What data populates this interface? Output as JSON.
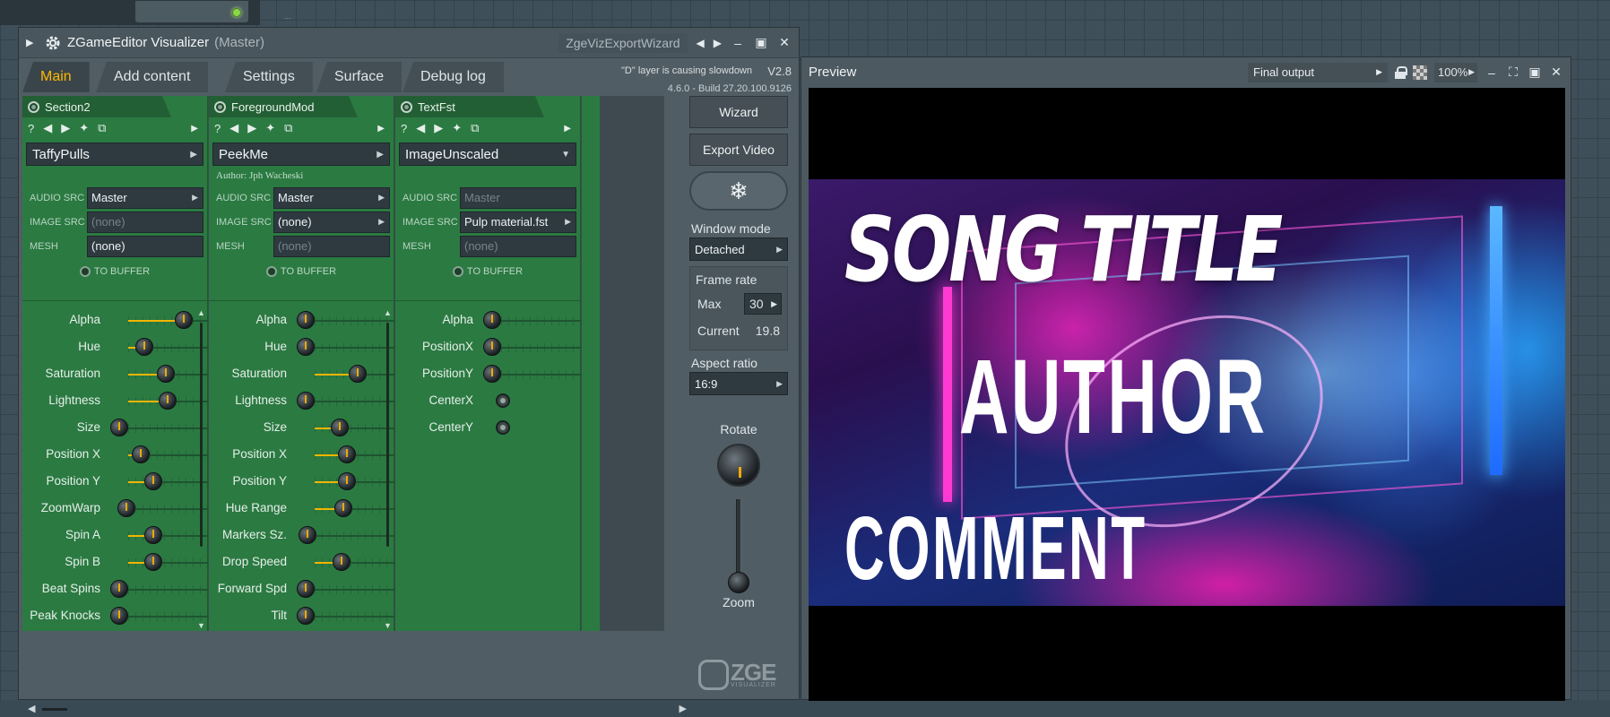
{
  "main_window": {
    "title": "ZGameEditor Visualizer",
    "title_sub": "(Master)",
    "preset_name": "ZgeVizExportWizard",
    "warning": "\"D\" layer is causing slowdown",
    "version": "V2.8",
    "build": "4.6.0 - Build 27.20.100.9126",
    "tabs": [
      "Main",
      "Add content",
      "Settings",
      "Surface",
      "Debug log"
    ],
    "active_tab": "Main"
  },
  "columns": [
    {
      "name": "Section2",
      "preset": "TaffyPulls",
      "author": "",
      "audio_src": "Master",
      "image_src": "(none)",
      "mesh": "(none)",
      "to_buffer": "TO BUFFER",
      "params": [
        {
          "label": "Alpha",
          "value": 0.9
        },
        {
          "label": "Hue",
          "value": 0.35
        },
        {
          "label": "Saturation",
          "value": 0.65
        },
        {
          "label": "Lightness",
          "value": 0.68
        },
        {
          "label": "Size",
          "value": 0.0
        },
        {
          "label": "Position X",
          "value": 0.3
        },
        {
          "label": "Position Y",
          "value": 0.48
        },
        {
          "label": "ZoomWarp",
          "value": 0.1
        },
        {
          "label": "Spin A",
          "value": 0.48
        },
        {
          "label": "Spin B",
          "value": 0.48
        },
        {
          "label": "Beat Spins",
          "value": 0.0
        },
        {
          "label": "Peak Knocks",
          "value": 0.0
        }
      ]
    },
    {
      "name": "ForegroundMod",
      "preset": "PeekMe",
      "author": "Author: Jph Wacheski",
      "audio_src": "Master",
      "image_src": "(none)",
      "mesh": "(none)",
      "to_buffer": "TO BUFFER",
      "params": [
        {
          "label": "Alpha",
          "value": 0.0
        },
        {
          "label": "Hue",
          "value": 0.0
        },
        {
          "label": "Saturation",
          "value": 0.72
        },
        {
          "label": "Lightness",
          "value": 0.0
        },
        {
          "label": "Size",
          "value": 0.48
        },
        {
          "label": "Position X",
          "value": 0.58
        },
        {
          "label": "Position Y",
          "value": 0.58
        },
        {
          "label": "Hue Range",
          "value": 0.52
        },
        {
          "label": "Markers Sz.",
          "value": 0.02
        },
        {
          "label": "Drop Speed",
          "value": 0.5
        },
        {
          "label": "Forward Spd",
          "value": 0.0
        },
        {
          "label": "Tilt",
          "value": 0.0
        }
      ]
    },
    {
      "name": "TextFst",
      "preset": "ImageUnscaled",
      "author": "",
      "audio_src": "Master",
      "image_src": "Pulp material.fst",
      "mesh": "(none)",
      "to_buffer": "TO BUFFER",
      "params": [
        {
          "label": "Alpha",
          "value": 0.0
        },
        {
          "label": "PositionX",
          "value": 0.0
        },
        {
          "label": "PositionY",
          "value": 0.0
        },
        {
          "label": "CenterX",
          "value": null
        },
        {
          "label": "CenterY",
          "value": null
        }
      ]
    }
  ],
  "field_labels": {
    "audio": "AUDIO SRC",
    "image": "IMAGE SRC",
    "mesh": "MESH"
  },
  "side_panel": {
    "wizard": "Wizard",
    "export_video": "Export Video",
    "window_mode_label": "Window mode",
    "window_mode": "Detached",
    "frame_rate_label": "Frame rate",
    "max_label": "Max",
    "max_value": "30",
    "current_label": "Current",
    "current_value": "19.8",
    "aspect_label": "Aspect ratio",
    "aspect_value": "16:9",
    "rotate_label": "Rotate",
    "zoom_label": "Zoom",
    "logo_word": "ZGE",
    "logo_sub": "VISUALIZER"
  },
  "preview": {
    "title": "Preview",
    "output": "Final output",
    "zoom": "100%",
    "song_title": "SONG TITLE",
    "author": "AUTHOR",
    "comment": "COMMENT"
  },
  "colors": {
    "accent": "#ffb800",
    "column_bg": "#2b7a42",
    "slider_fill": "#f2b400"
  }
}
